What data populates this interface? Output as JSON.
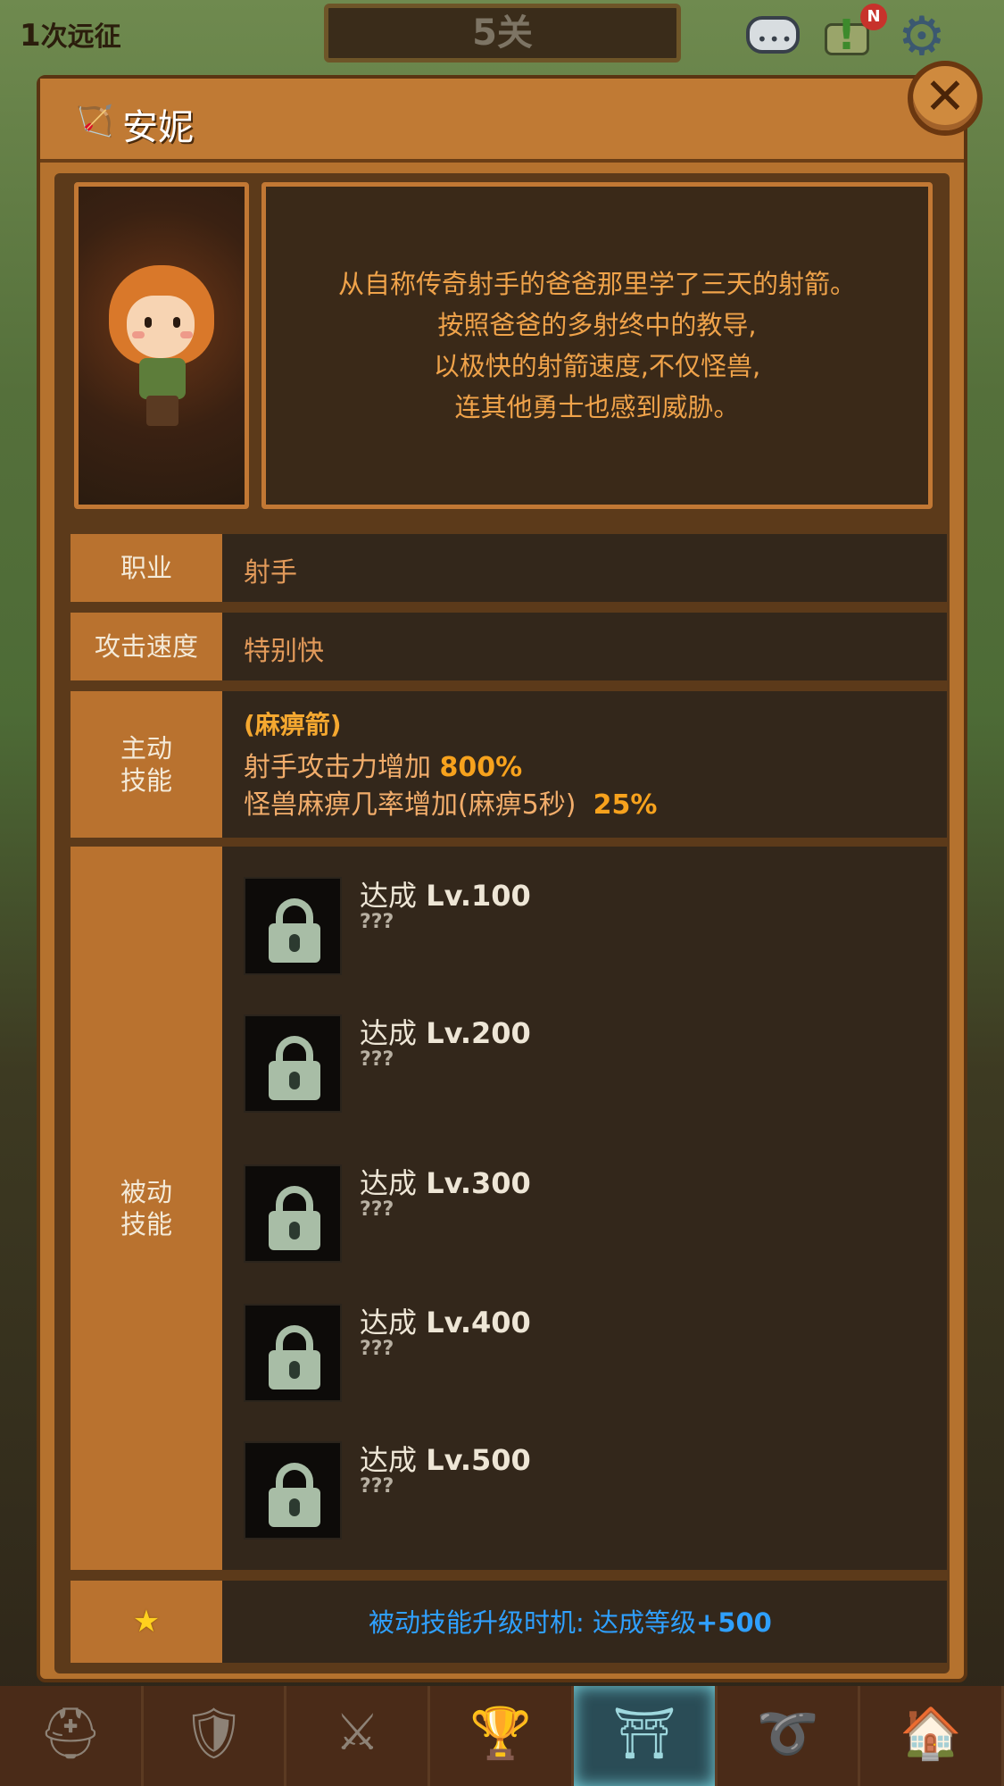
{
  "hud": {
    "expedition_count": "1",
    "expedition_label": "次远征",
    "stage": "5关",
    "notification_badge": "N"
  },
  "panel": {
    "hero_name": "安妮",
    "close_symbol": "✕",
    "description_lines": [
      "从自称传奇射手的爸爸那里学了三天的射箭。",
      "按照爸爸的多射终中的教导,",
      "以极快的射箭速度,不仅怪兽,",
      "连其他勇士也感到威胁。"
    ],
    "class": {
      "label": "职业",
      "value": "射手"
    },
    "attack_speed": {
      "label": "攻击速度",
      "value": "特别快"
    },
    "active_skill": {
      "label": "主动技能",
      "name": "(麻痹箭)",
      "line1_text": "射手攻击力增加",
      "line1_value": "800%",
      "line2_text": "怪兽麻痹几率增加(麻痹5秒)",
      "line2_value": "25%"
    },
    "passive_skill": {
      "label": "被动技能",
      "items": [
        {
          "prefix": "达成",
          "level": "Lv.100",
          "desc": "???"
        },
        {
          "prefix": "达成",
          "level": "Lv.200",
          "desc": "???"
        },
        {
          "prefix": "达成",
          "level": "Lv.300",
          "desc": "???"
        },
        {
          "prefix": "达成",
          "level": "Lv.400",
          "desc": "???"
        },
        {
          "prefix": "达成",
          "level": "Lv.500",
          "desc": "???"
        }
      ]
    },
    "upgrade_info": {
      "text": "被动技能升级时机:  达成等级",
      "value": "+500"
    }
  },
  "icons": {
    "hero_class": "bow-icon",
    "lock": "lock-icon",
    "star": "star-icon"
  },
  "nav_tabs": [
    "knight-helmet-icon",
    "armor-icon",
    "crossed-swords-icon",
    "trophy-icon",
    "dungeon-gate-icon",
    "belt-icon",
    "shop-icon"
  ]
}
